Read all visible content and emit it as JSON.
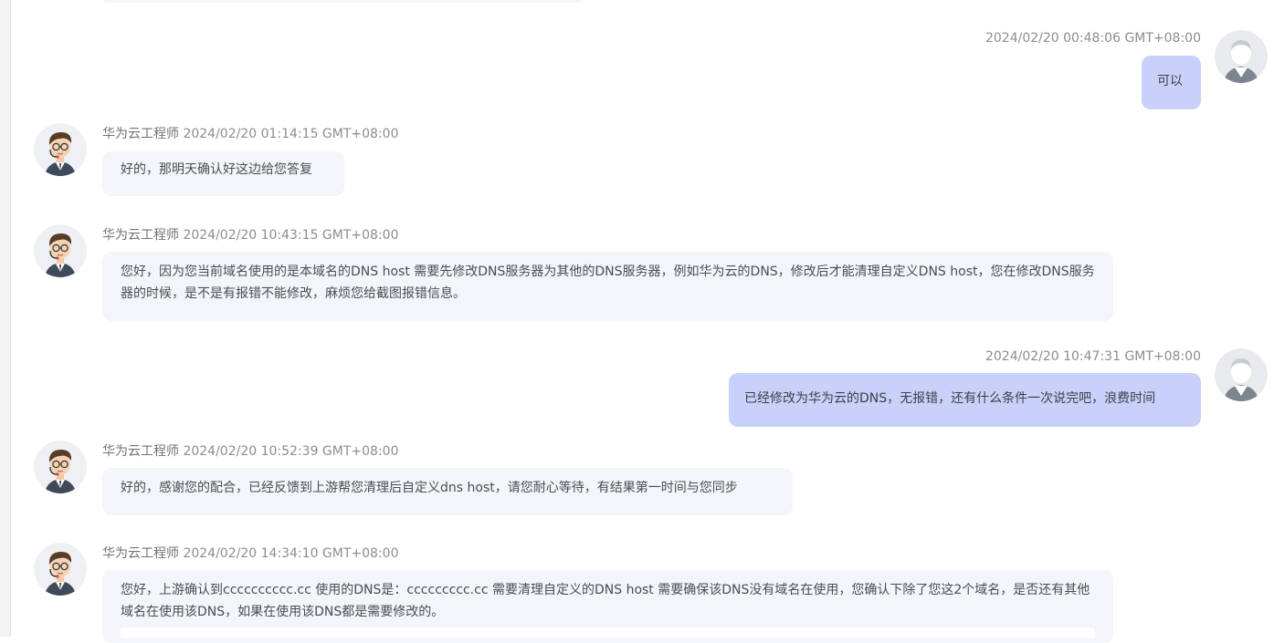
{
  "conversation": {
    "messages": [
      {
        "role": "user",
        "timestamp": "2024/02/20 00:48:06 GMT+08:00",
        "text": "可以"
      },
      {
        "role": "engineer",
        "sender": "华为云工程师",
        "timestamp": "2024/02/20 01:14:15 GMT+08:00",
        "text": "好的，那明天确认好这边给您答复"
      },
      {
        "role": "engineer",
        "sender": "华为云工程师",
        "timestamp": "2024/02/20 10:43:15 GMT+08:00",
        "text": "您好，因为您当前域名使用的是本域名的DNS host 需要先修改DNS服务器为其他的DNS服务器，例如华为云的DNS，修改后才能清理自定义DNS host，您在修改DNS服务器的时候，是不是有报错不能修改，麻烦您给截图报错信息。"
      },
      {
        "role": "user",
        "timestamp": "2024/02/20 10:47:31 GMT+08:00",
        "text": "已经修改为华为云的DNS，无报错，还有什么条件一次说完吧，浪费时间"
      },
      {
        "role": "engineer",
        "sender": "华为云工程师",
        "timestamp": "2024/02/20 10:52:39 GMT+08:00",
        "text": "好的，感谢您的配合，已经反馈到上游帮您清理后自定义dns host，请您耐心等待，有结果第一时间与您同步"
      },
      {
        "role": "engineer",
        "sender": "华为云工程师",
        "timestamp": "2024/02/20 14:34:10 GMT+08:00",
        "text": "您好，上游确认到cccccccccc.cc  使用的DNS是：ccccccccc.cc  需要清理自定义的DNS host 需要确保该DNS没有域名在使用，您确认下除了您这2个域名，是否还有其他域名在使用该DNS，如果在使用该DNS都是需要修改的。"
      }
    ]
  },
  "icons": {
    "engineer_avatar": "engineer-avatar-icon",
    "user_avatar": "user-avatar-icon"
  },
  "colors": {
    "engineer_bubble": "#f4f5fb",
    "user_bubble": "#c9d1fb",
    "meta_text": "#8a8d94"
  }
}
